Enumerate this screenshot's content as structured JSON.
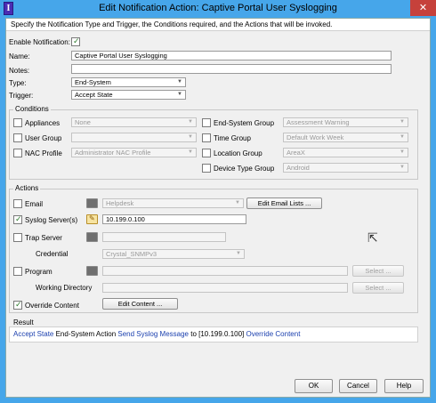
{
  "window": {
    "title": "Edit Notification Action: Captive Portal User Syslogging",
    "close_glyph": "✕",
    "app_icon_glyph": "I"
  },
  "description": "Specify the Notification Type and Trigger, the Conditions required, and the Actions that will be invoked.",
  "form": {
    "enable_label": "Enable Notification:",
    "enable_checked": true,
    "name_label": "Name:",
    "name_value": "Captive Portal User Syslogging",
    "notes_label": "Notes:",
    "notes_value": "",
    "type_label": "Type:",
    "type_value": "End-System",
    "trigger_label": "Trigger:",
    "trigger_value": "Accept State"
  },
  "conditions": {
    "title": "Conditions",
    "left": [
      {
        "label": "Appliances",
        "value": "None",
        "checked": false
      },
      {
        "label": "User Group",
        "value": "",
        "checked": false
      },
      {
        "label": "NAC Profile",
        "value": "Administrator NAC Profile",
        "checked": false
      }
    ],
    "right": [
      {
        "label": "End-System Group",
        "value": "Assessment Warning",
        "checked": false
      },
      {
        "label": "Time Group",
        "value": "Default Work Week",
        "checked": false
      },
      {
        "label": "Location Group",
        "value": "AreaX",
        "checked": false
      },
      {
        "label": "Device Type Group",
        "value": "Android",
        "checked": false
      }
    ]
  },
  "actions": {
    "title": "Actions",
    "email_label": "Email",
    "email_checked": false,
    "email_value": "Helpdesk",
    "edit_email_lists_label": "Edit Email Lists ...",
    "syslog_label": "Syslog Server(s)",
    "syslog_checked": true,
    "syslog_value": "10.199.0.100",
    "trap_label": "Trap Server",
    "trap_checked": false,
    "trap_value": "",
    "credential_label": "Credential",
    "credential_value": "Crystal_SNMPv3",
    "program_label": "Program",
    "program_checked": false,
    "program_value": "",
    "program_select_label": "Select ...",
    "working_dir_label": "Working Directory",
    "working_dir_value": "",
    "working_dir_select_label": "Select ...",
    "override_label": "Override Content",
    "override_checked": true,
    "edit_content_label": "Edit Content ..."
  },
  "result": {
    "title": "Result",
    "parts": [
      {
        "text": "Accept State",
        "link": true
      },
      {
        "text": " End-System Action ",
        "link": false
      },
      {
        "text": "Send Syslog Message",
        "link": true
      },
      {
        "text": " to [10.199.0.100] ",
        "link": false
      },
      {
        "text": "Override Content",
        "link": true
      }
    ]
  },
  "footer": {
    "ok_label": "OK",
    "cancel_label": "Cancel",
    "help_label": "Help"
  },
  "icons": {
    "dropdown_arrow": "▼",
    "cursor": "⇱"
  }
}
